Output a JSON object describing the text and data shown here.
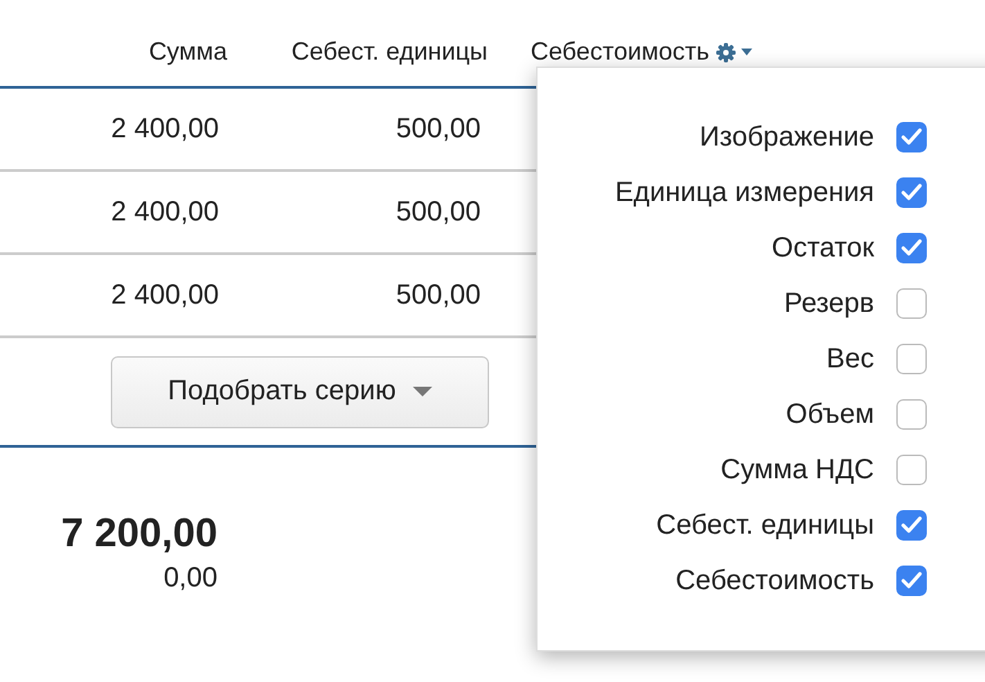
{
  "table": {
    "columns": [
      "Сумма",
      "Себест. единицы",
      "Себестоимость"
    ],
    "rows": [
      [
        "2 400,00",
        "500,00"
      ],
      [
        "2 400,00",
        "500,00"
      ],
      [
        "2 400,00",
        "500,00"
      ]
    ]
  },
  "series_button": {
    "label": "Подобрать серию"
  },
  "totals": {
    "sum": "7 200,00",
    "secondary": "0,00"
  },
  "column_menu": {
    "items": [
      {
        "label": "Изображение",
        "checked": true
      },
      {
        "label": "Единица измерения",
        "checked": true
      },
      {
        "label": "Остаток",
        "checked": true
      },
      {
        "label": "Резерв",
        "checked": false
      },
      {
        "label": "Вес",
        "checked": false
      },
      {
        "label": "Объем",
        "checked": false
      },
      {
        "label": "Сумма НДС",
        "checked": false
      },
      {
        "label": "Себест. единицы",
        "checked": true
      },
      {
        "label": "Себестоимость",
        "checked": true
      }
    ]
  }
}
